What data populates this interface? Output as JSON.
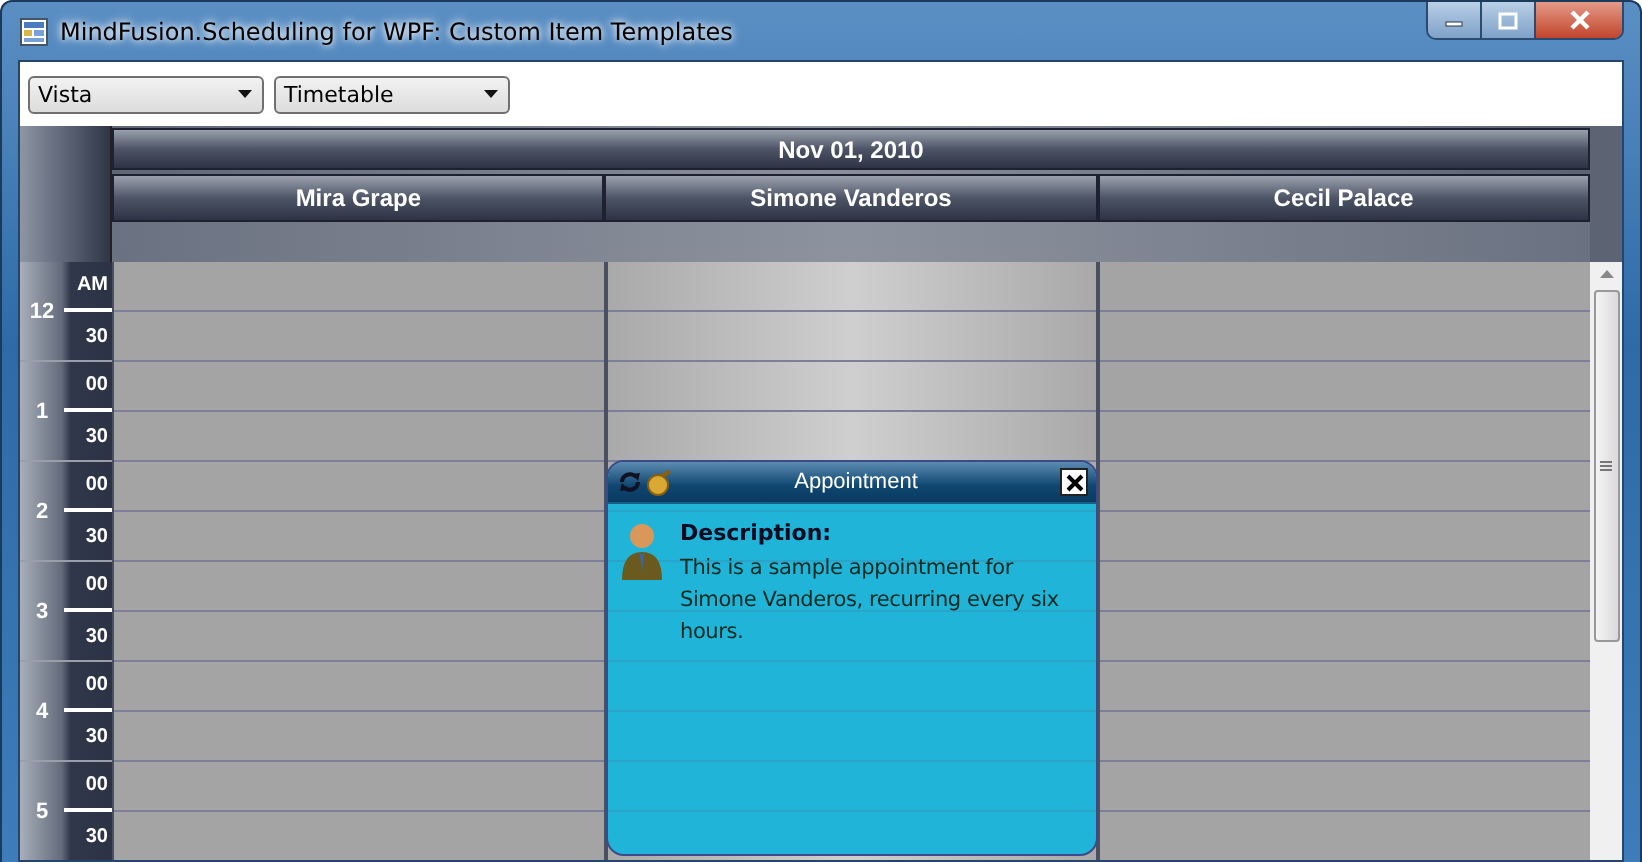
{
  "window": {
    "title": "MindFusion.Scheduling for WPF: Custom Item Templates"
  },
  "toolbar": {
    "dropdowns": [
      {
        "value": "Vista"
      },
      {
        "value": "Timetable"
      }
    ]
  },
  "schedule": {
    "date": "Nov 01, 2010",
    "resources": [
      {
        "name": "Mira Grape",
        "selected": false
      },
      {
        "name": "Simone Vanderos",
        "selected": true
      },
      {
        "name": "Cecil Palace",
        "selected": false
      }
    ],
    "hours": [
      {
        "hour": "12",
        "slots": [
          "AM",
          "30"
        ]
      },
      {
        "hour": "1",
        "slots": [
          "00",
          "30"
        ]
      },
      {
        "hour": "2",
        "slots": [
          "00",
          "30"
        ]
      },
      {
        "hour": "3",
        "slots": [
          "00",
          "30"
        ]
      },
      {
        "hour": "4",
        "slots": [
          "00",
          "30"
        ]
      },
      {
        "hour": "5",
        "slots": [
          "00",
          "30"
        ]
      }
    ]
  },
  "appointment": {
    "title": "Appointment",
    "heading": "Description:",
    "text": "This is a sample appointment for Simone Vanderos, recurring every six hours."
  }
}
